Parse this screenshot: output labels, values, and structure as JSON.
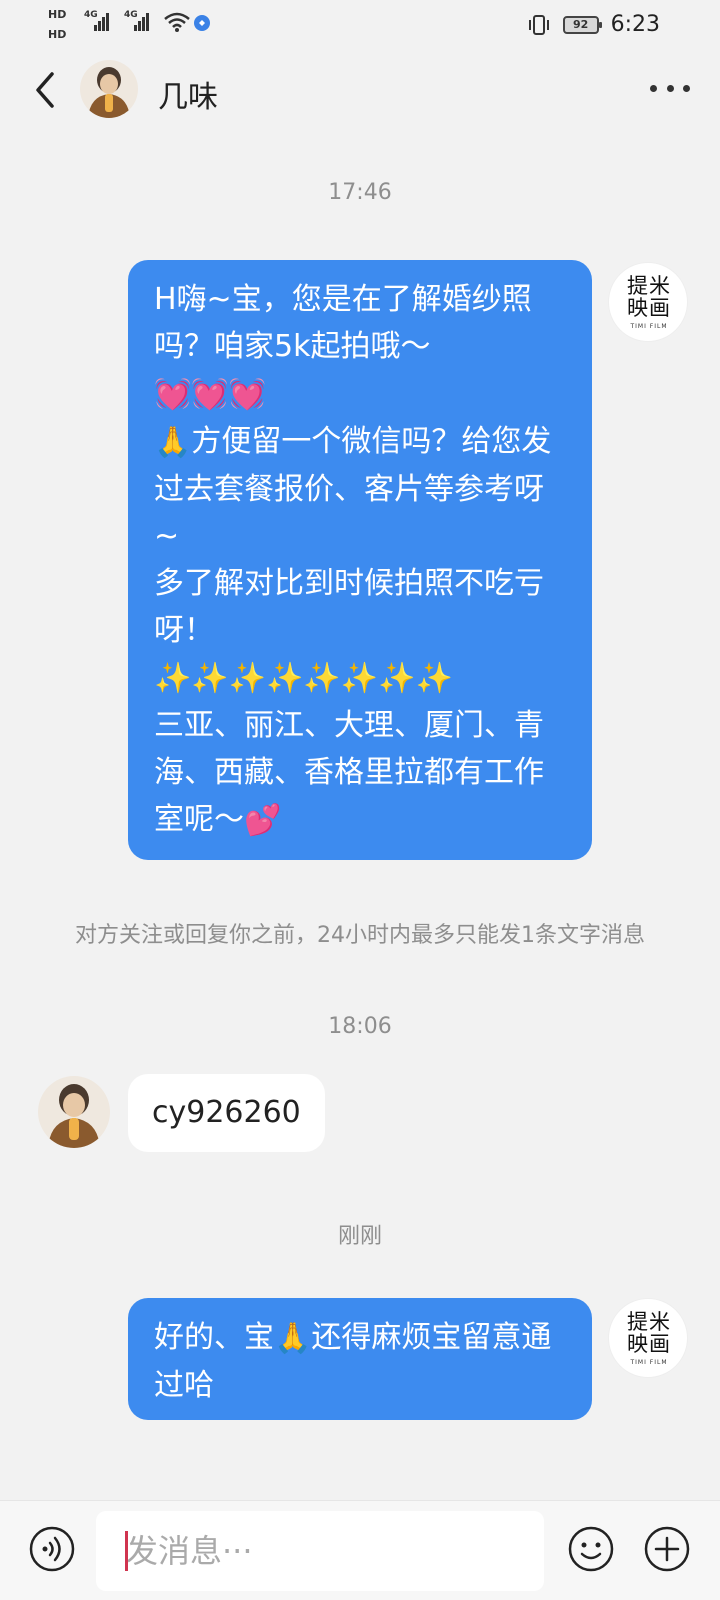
{
  "status_bar": {
    "left_items": [
      "HD",
      "HD",
      "4G",
      "4G"
    ],
    "battery": "92",
    "time": "6:23"
  },
  "header": {
    "contact_name": "几味"
  },
  "chat": {
    "timestamps": [
      "17:46",
      "18:06",
      "刚刚"
    ],
    "sender_logo": {
      "text_line1": "提米",
      "text_line2": "映画",
      "sub": "TIMI FILM"
    },
    "message1": {
      "lines": [
        "H嗨~宝，您是在了解婚纱照吗？咱家5k起拍哦～",
        "方便留一个微信吗？给您发过去套餐报价、客片等参考呀~",
        "多了解对比到时候拍照不吃亏呀！",
        "三亚、丽江、大理、厦门、青海、西藏、香格里拉都有工作室呢～"
      ],
      "emojis": {
        "hearts": "💓💓💓",
        "face": "🙏",
        "sparkles": "✨✨✨✨✨✨✨✨",
        "love": "💕"
      }
    },
    "system_note": "对方关注或回复你之前，24小时内最多只能发1条文字消息",
    "message2": {
      "text": "cy926260"
    },
    "message3": {
      "text_before": "好的、宝",
      "text_after": "还得麻烦宝留意通过哈",
      "emoji": "🙏"
    }
  },
  "input_bar": {
    "placeholder": "发消息···"
  },
  "colors": {
    "bubble_out": "#3d8bef",
    "bubble_in": "#ffffff",
    "background": "#f2f2f2"
  }
}
